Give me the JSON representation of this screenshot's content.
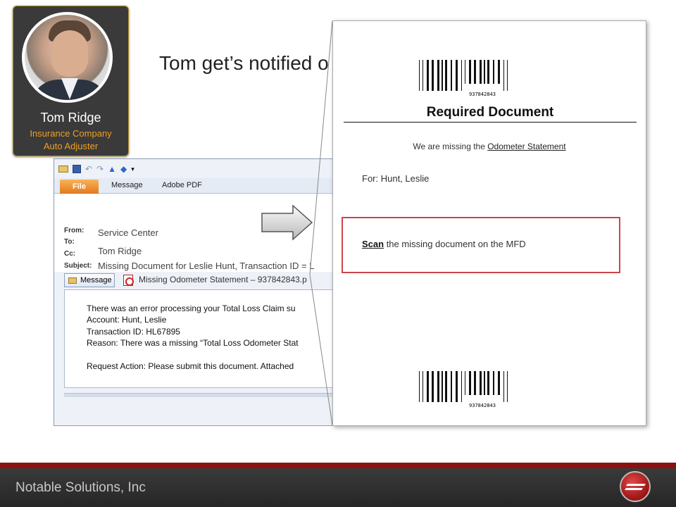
{
  "profile": {
    "name": "Tom Ridge",
    "role_line1": "Insurance Company",
    "role_line2": "Auto Adjuster"
  },
  "headline": "Tom get’s notified o",
  "email": {
    "tabs": [
      "File",
      "Message",
      "Adobe PDF"
    ],
    "labels": {
      "from": "From:",
      "to": "To:",
      "cc": "Cc:",
      "subject": "Subject:"
    },
    "from": "Service Center",
    "to": "Tom Ridge",
    "subject": "Missing Document for Leslie Hunt, Transaction ID = L",
    "message_button": "Message",
    "attachment": "Missing Odometer Statement – 937842843.p",
    "body": [
      "There was an error processing your Total Loss Claim su",
      "Account: Hunt, Leslie",
      "Transaction ID: HL67895",
      "Reason: There was a missing “Total Loss Odometer Stat",
      "",
      "Request Action: Please submit this document.  Attached"
    ]
  },
  "document": {
    "barcode_number": "937842843",
    "title": "Required Document",
    "missing_prefix": "We are missing the ",
    "missing_item": "Odometer Statement",
    "for_text": "For: Hunt, Leslie",
    "scan_word": "Scan",
    "scan_rest": " the missing document on the MFD"
  },
  "footer": {
    "company": "Notable Solutions, Inc"
  },
  "colors": {
    "accent_red": "#8b1010",
    "file_tab_orange": "#e4791b",
    "role_orange": "#f0a020",
    "scan_box_red": "#c9474a"
  }
}
